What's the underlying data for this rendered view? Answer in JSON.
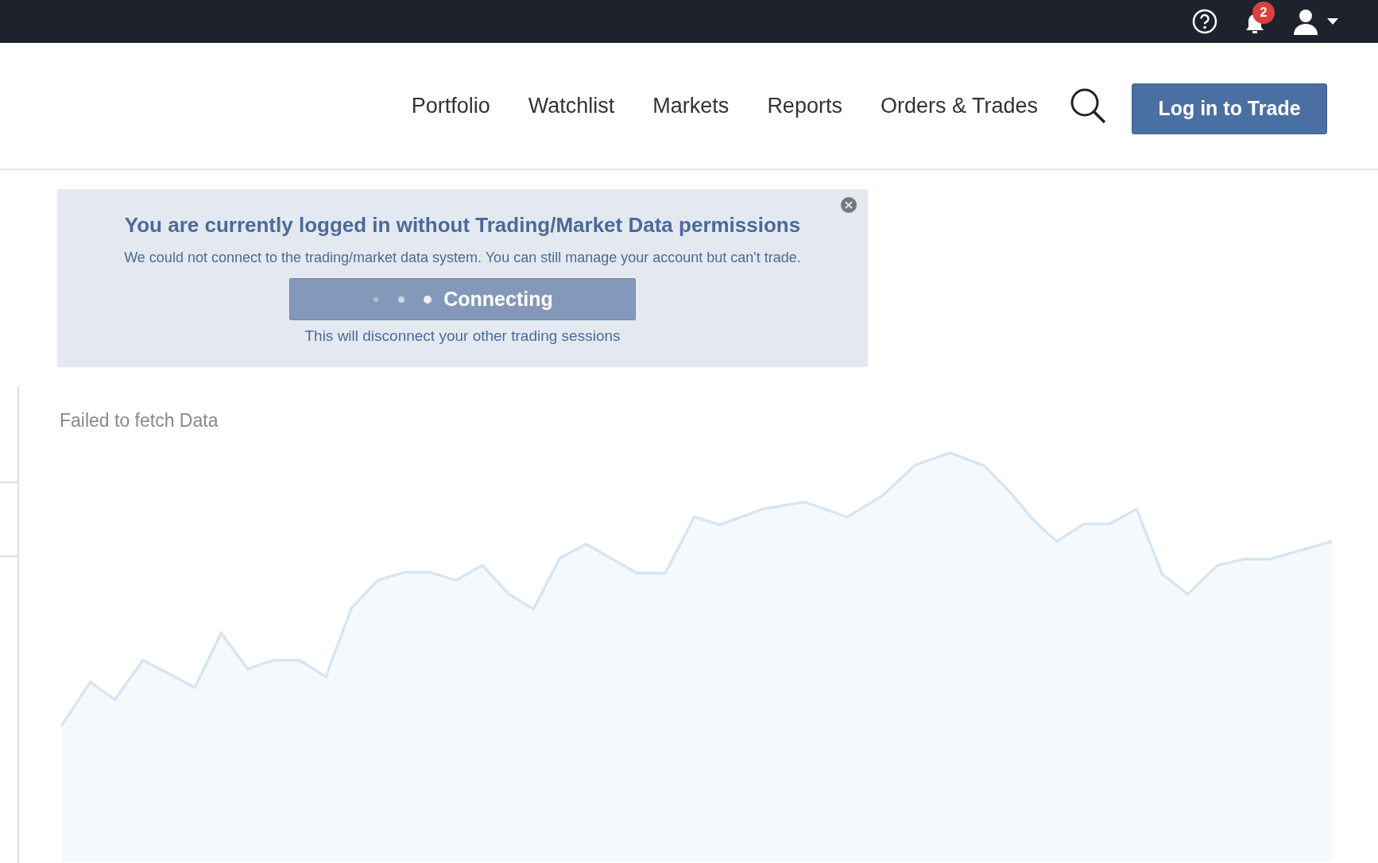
{
  "top_bar": {
    "notification_count": "2"
  },
  "nav": {
    "links": [
      {
        "label": "Portfolio"
      },
      {
        "label": "Watchlist"
      },
      {
        "label": "Markets"
      },
      {
        "label": "Reports"
      },
      {
        "label": "Orders & Trades"
      }
    ],
    "login_button": "Log in to Trade"
  },
  "alert": {
    "title": "You are currently logged in without Trading/Market Data permissions",
    "message": "We could not connect to the trading/market data system. You can still manage your account but can't trade.",
    "button": "Connecting",
    "note": "This will disconnect your other trading sessions"
  },
  "chart_panel": {
    "message": "Failed to fetch Data"
  }
}
